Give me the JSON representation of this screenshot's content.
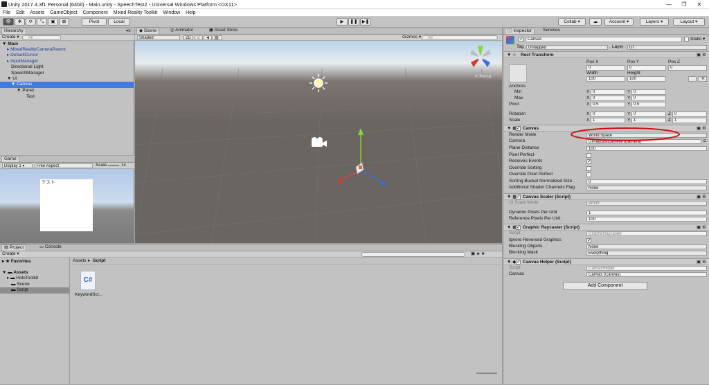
{
  "window": {
    "title": "Unity 2017.4.3f1 Personal (64bit) - Main.unity - SpeechTest2 - Universal Windows Platform <DX11>"
  },
  "menu": [
    "File",
    "Edit",
    "Assets",
    "GameObject",
    "Component",
    "Mixed Reality Toolkit",
    "Window",
    "Help"
  ],
  "toolbar": {
    "pivot": "Pivot",
    "local": "Local",
    "collab": "Collab ▾",
    "account": "Account",
    "layers": "Layers",
    "layout": "Layout"
  },
  "hierarchy": {
    "tab": "Hierarchy",
    "create": "Create ▾",
    "search": "All",
    "scene": "Main",
    "items": [
      "MixedRealityCameraParent",
      "DefaultCursor",
      "InputManager",
      "Directional Light",
      "SpeechManager",
      "UI",
      "Canvas",
      "Panel",
      "Text"
    ]
  },
  "scene_view": {
    "tab_scene": "Scene",
    "tab_animator": "Animator",
    "tab_asset_store": "Asset Store",
    "shaded": "Shaded",
    "mode_2d": "2D",
    "gizmos": "Gizmos ▾",
    "search": "All",
    "persp": "≺ Persp"
  },
  "game": {
    "tab": "Game",
    "display": "Display 1",
    "aspect": "Free Aspect",
    "scale": "Scale",
    "scale_value": "1x",
    "canvas_text": "テスト"
  },
  "project": {
    "tab_project": "Project",
    "tab_console": "Console",
    "create": "Create ▾",
    "favorites": "Favorites",
    "assets": "Assets",
    "folders": [
      "HoloToolkit",
      "Scene",
      "Script"
    ],
    "breadcrumb": [
      "Assets",
      "Script"
    ],
    "file_name": "KeywordScr..."
  },
  "inspector": {
    "tab_inspector": "Inspector",
    "tab_services": "Services",
    "object_name": "Canvas",
    "static": "Static ▾",
    "tag_label": "Tag",
    "tag": "Untagged",
    "layer_label": "Layer",
    "layer": "UI",
    "rect": {
      "title": "Rect Transform",
      "pos_x_label": "Pos X",
      "pos_y_label": "Pos Y",
      "pos_z_label": "Pos Z",
      "pos_x": "0",
      "pos_y": "0",
      "pos_z": "0",
      "width_label": "Width",
      "height_label": "Height",
      "width": "100",
      "height": "100",
      "anchors": "Anchors",
      "min": "Min",
      "max": "Max",
      "pivot": "Pivot",
      "rotation": "Rotation",
      "scale": "Scale",
      "min_x": "0",
      "min_y": "0",
      "max_x": "0",
      "max_y": "0",
      "pivot_x": "0.5",
      "pivot_y": "0.5",
      "rot_x": "0",
      "rot_y": "0",
      "rot_z": "0",
      "scale_x": "1",
      "scale_y": "1",
      "scale_z": "1",
      "x": "X",
      "y": "Y",
      "z": "Z",
      "r_btn": "R"
    },
    "canvas": {
      "title": "Canvas",
      "labels": [
        "Render Mode",
        "Camera",
        "Plane Distance",
        "Pixel Perfect",
        "Receives Events",
        "Override Sorting",
        "Override Pixel Perfect",
        "Sorting Bucket Normalized Size",
        "Additional Shader Channels Flag"
      ],
      "render_mode": "World Space",
      "camera": "UIRaycastCamera (Camera)",
      "plane_distance": "100",
      "sorting_bucket": "0",
      "shader_channels": "None"
    },
    "scaler": {
      "title": "Canvas Scaler (Script)",
      "ui_scale_mode_label": "UI Scale Mode",
      "ui_scale_mode": "World",
      "dpu_label": "Dynamic Pixels Per Unit",
      "dpu": "1",
      "rppu_label": "Reference Pixels Per Unit",
      "rppu": "100"
    },
    "raycaster": {
      "title": "Graphic Raycaster (Script)",
      "script_label": "Script",
      "script": "GraphicRaycaster",
      "ignore_label": "Ignore Reversed Graphics",
      "blocking_objects_label": "Blocking Objects",
      "blocking_objects": "None",
      "blocking_mask_label": "Blocking Mask",
      "blocking_mask": "Everything"
    },
    "helper": {
      "title": "Canvas Helper (Script)",
      "script_label": "Script",
      "script": "CanvasHelper",
      "canvas_label": "Canvas",
      "canvas": "Canvas (Canvas)"
    },
    "add_component": "Add Component"
  },
  "colors": {
    "selection": "#3e7ce4",
    "scene_ground": "#6b6562",
    "annotation": "#d01010"
  }
}
